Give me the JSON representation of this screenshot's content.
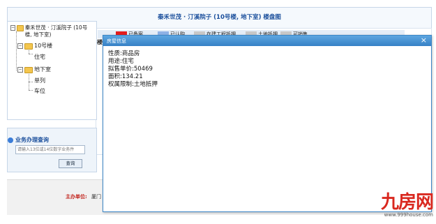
{
  "header": {
    "title": "秦禾世茂 · 汀溪院子 (10号楼, 地下室)   楼盘图"
  },
  "tree": {
    "root_label": "秦禾世茂 · 汀溪院子 (10号楼, 地下室)",
    "building_label": "10号楼",
    "building_child": "住宅",
    "basement_label": "地下室",
    "basement_children": [
      "单列",
      "车位"
    ]
  },
  "legend": {
    "items": [
      {
        "label": "已备案",
        "color": "#e31c1c"
      },
      {
        "label": "已认购",
        "color": "#8fb2e6"
      },
      {
        "label": "在建工程抵押",
        "color": "#c8c8c8"
      },
      {
        "label": "土地抵押",
        "color": "#c8c8c8"
      },
      {
        "label": "可销售",
        "color": "#c8c8c8"
      }
    ]
  },
  "map": {
    "side_label": "楼"
  },
  "query": {
    "title": "业务办理查询",
    "placeholder": "请输入13位或14位数字业务件",
    "button_label": "查询"
  },
  "footer": {
    "label": "主办单位:",
    "value": "厦门"
  },
  "modal": {
    "title": "房屋信息",
    "close_glyph": "×",
    "lines": [
      "性质:商品房",
      "用途:住宅",
      "拟售单价:50469",
      "面积:134.21",
      "权属限制:土地抵押"
    ]
  },
  "logo": {
    "text": "九房网",
    "url": "www.999house.com"
  }
}
